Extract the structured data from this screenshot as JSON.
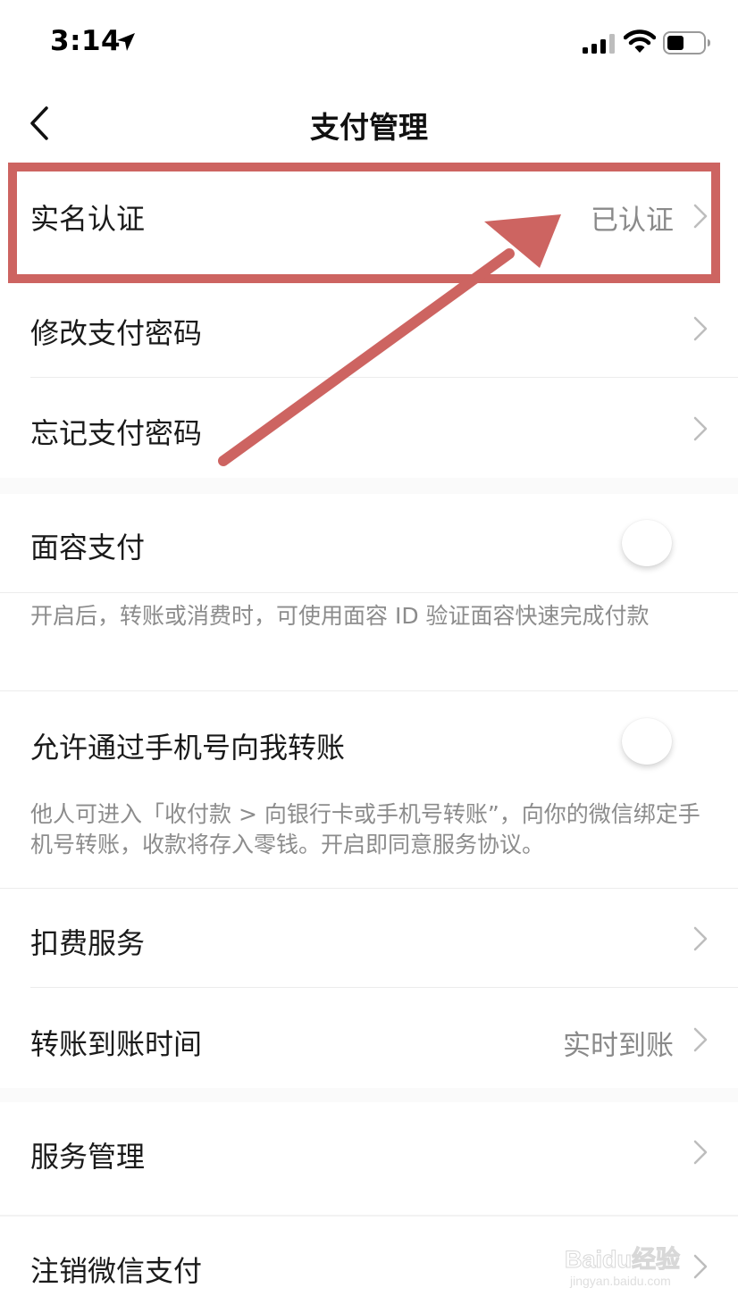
{
  "status_bar": {
    "time": "3:14"
  },
  "nav": {
    "title": "支付管理"
  },
  "rows": {
    "realname": {
      "label": "实名认证",
      "value": "已认证"
    },
    "change_pwd": {
      "label": "修改支付密码"
    },
    "forgot_pwd": {
      "label": "忘记支付密码"
    },
    "face_pay": {
      "label": "面容支付",
      "enabled": false,
      "desc": "开启后，转账或消费时，可使用面容 ID 验证面容快速完成付款"
    },
    "phone_transfer": {
      "label": "允许通过手机号向我转账",
      "enabled": false,
      "desc": "他人可进入「收付款 > 向银行卡或手机号转账”，向你的微信绑定手机号转账，收款将存入零钱。开启即同意服务协议。"
    },
    "deduct": {
      "label": "扣费服务"
    },
    "arrival_time": {
      "label": "转账到账时间",
      "value": "实时到账"
    },
    "service_mgmt": {
      "label": "服务管理"
    },
    "cancel_pay": {
      "label": "注销微信支付"
    }
  },
  "watermark": {
    "main": "Baidu经验",
    "sub": "jingyan.baidu.com"
  },
  "colors": {
    "annotation": "#cd6461",
    "secondary_text": "#8a8a8a",
    "background": "#ffffff"
  }
}
